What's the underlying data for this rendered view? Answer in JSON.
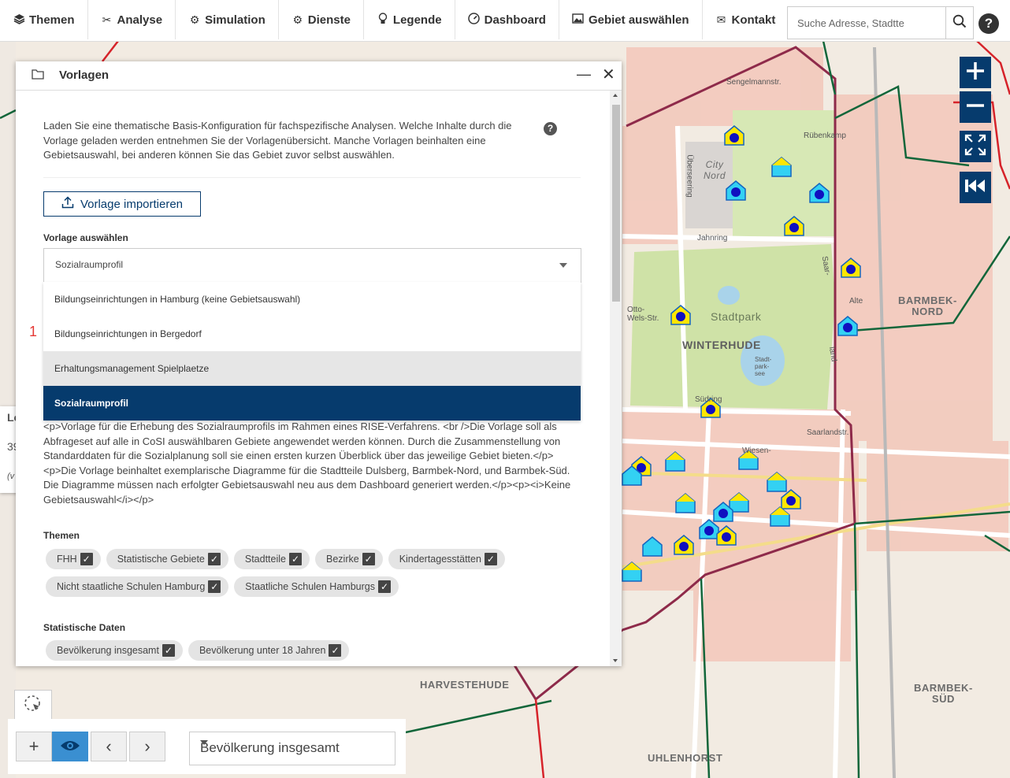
{
  "nav": {
    "items": [
      {
        "label": "Themen",
        "icon": "layers-icon"
      },
      {
        "label": "Analyse",
        "icon": "tools-icon"
      },
      {
        "label": "Simulation",
        "icon": "gear-icon"
      },
      {
        "label": "Dienste",
        "icon": "cog-icon"
      },
      {
        "label": "Legende",
        "icon": "lightbulb-icon"
      },
      {
        "label": "Dashboard",
        "icon": "speedometer-icon"
      },
      {
        "label": "Gebiet auswählen",
        "icon": "image-icon"
      },
      {
        "label": "Kontakt",
        "icon": "envelope-icon"
      }
    ],
    "search_placeholder": "Suche Adresse, Stadtte",
    "help_label": "?"
  },
  "panel": {
    "title": "Vorlagen",
    "intro": "Laden Sie eine thematische Basis-Konfiguration für fachspezifische Analysen. Welche Inhalte durch die Vorlage geladen werden entnehmen Sie der Vorlagenübersicht. Manche Vorlagen beinhalten eine Gebietsauswahl, bei anderen können Sie das Gebiet zuvor selbst auswählen.",
    "info_label": "?",
    "import_label": "Vorlage importieren",
    "select_label": "Vorlage auswählen",
    "select_value": "Sozialraumprofil",
    "dropdown_items": [
      "Bildungseinrichtungen in Hamburg (keine Gebietsauswahl)",
      "Bildungseinrichtungen in Bergedorf",
      "Erhaltungsmanagement Spielplaetze",
      "Sozialraumprofil"
    ],
    "red_marker": "1",
    "description": "<p>Vorlage für die Erhebung des Sozialraumprofils im Rahmen eines RISE-Verfahrens. <br />Die Vorlage soll als Abfrageset auf alle in CoSI auswählbaren Gebiete angewendet werden können. Durch die Zusammenstellung von Standarddaten für die Sozialplanung soll sie einen ersten kurzen Überblick über das jeweilige Gebiet bieten.</p><p>Die Vorlage beinhaltet exemplarische Diagramme für die Stadtteile Dulsberg, Barmbek-Nord, und Barmbek-Süd. Die Diagramme müssen nach erfolgter Gebietsauswahl neu aus dem Dashboard generiert werden.</p><p><i>Keine Gebietsauswahl</i></p>",
    "themen_label": "Themen",
    "themen": [
      "FHH",
      "Statistische Gebiete",
      "Stadtteile",
      "Bezirke",
      "Kindertagesstätten",
      "Nicht staatliche Schulen Hamburg",
      "Staatliche Schulen Hamburgs"
    ],
    "stat_label": "Statistische Daten",
    "stat": [
      "Bevölkerung insgesamt",
      "Bevölkerung unter 18 Jahren"
    ]
  },
  "side_card": {
    "line1": "Lo",
    "line2": "39",
    "line3": "(v"
  },
  "bottom": {
    "add_label": "+",
    "prev_label": "‹",
    "next_label": "›",
    "layer_value": "Bevölkerung insgesamt"
  },
  "map": {
    "labels": {
      "winterhude": "WINTERHUDE",
      "stadtpark": "Stadtpark",
      "city_nord": "City\nNord",
      "barmbek_nord": "BARMBEK-\nNORD",
      "barmbek_sued": "BARMBEK-\nSÜD",
      "harvestehude": "HARVESTEHUDE",
      "uhlenhorst": "UHLENHORST"
    },
    "streets": {
      "jahnring": "Jahnring",
      "suedring": "Südring",
      "saarlandstr": "Saarlandstr.",
      "wiesen": "Wiesen-",
      "ruebenkamp": "Rübenkamp",
      "sengelmannstr": "Sengelmannstr.",
      "ueberseering": "Überseering",
      "alte": "Alte",
      "stadtparksee": "Stadt-\npark-\nsee",
      "ottoweis": "Otto-\nWels-Str.",
      "saar": "Saar-",
      "land": "land-"
    }
  },
  "colors": {
    "primary": "#063b6d",
    "border_red": "#d6232a",
    "district_green": "#12663a",
    "park": "#cfe3a8",
    "urban": "#f4cfc4"
  }
}
